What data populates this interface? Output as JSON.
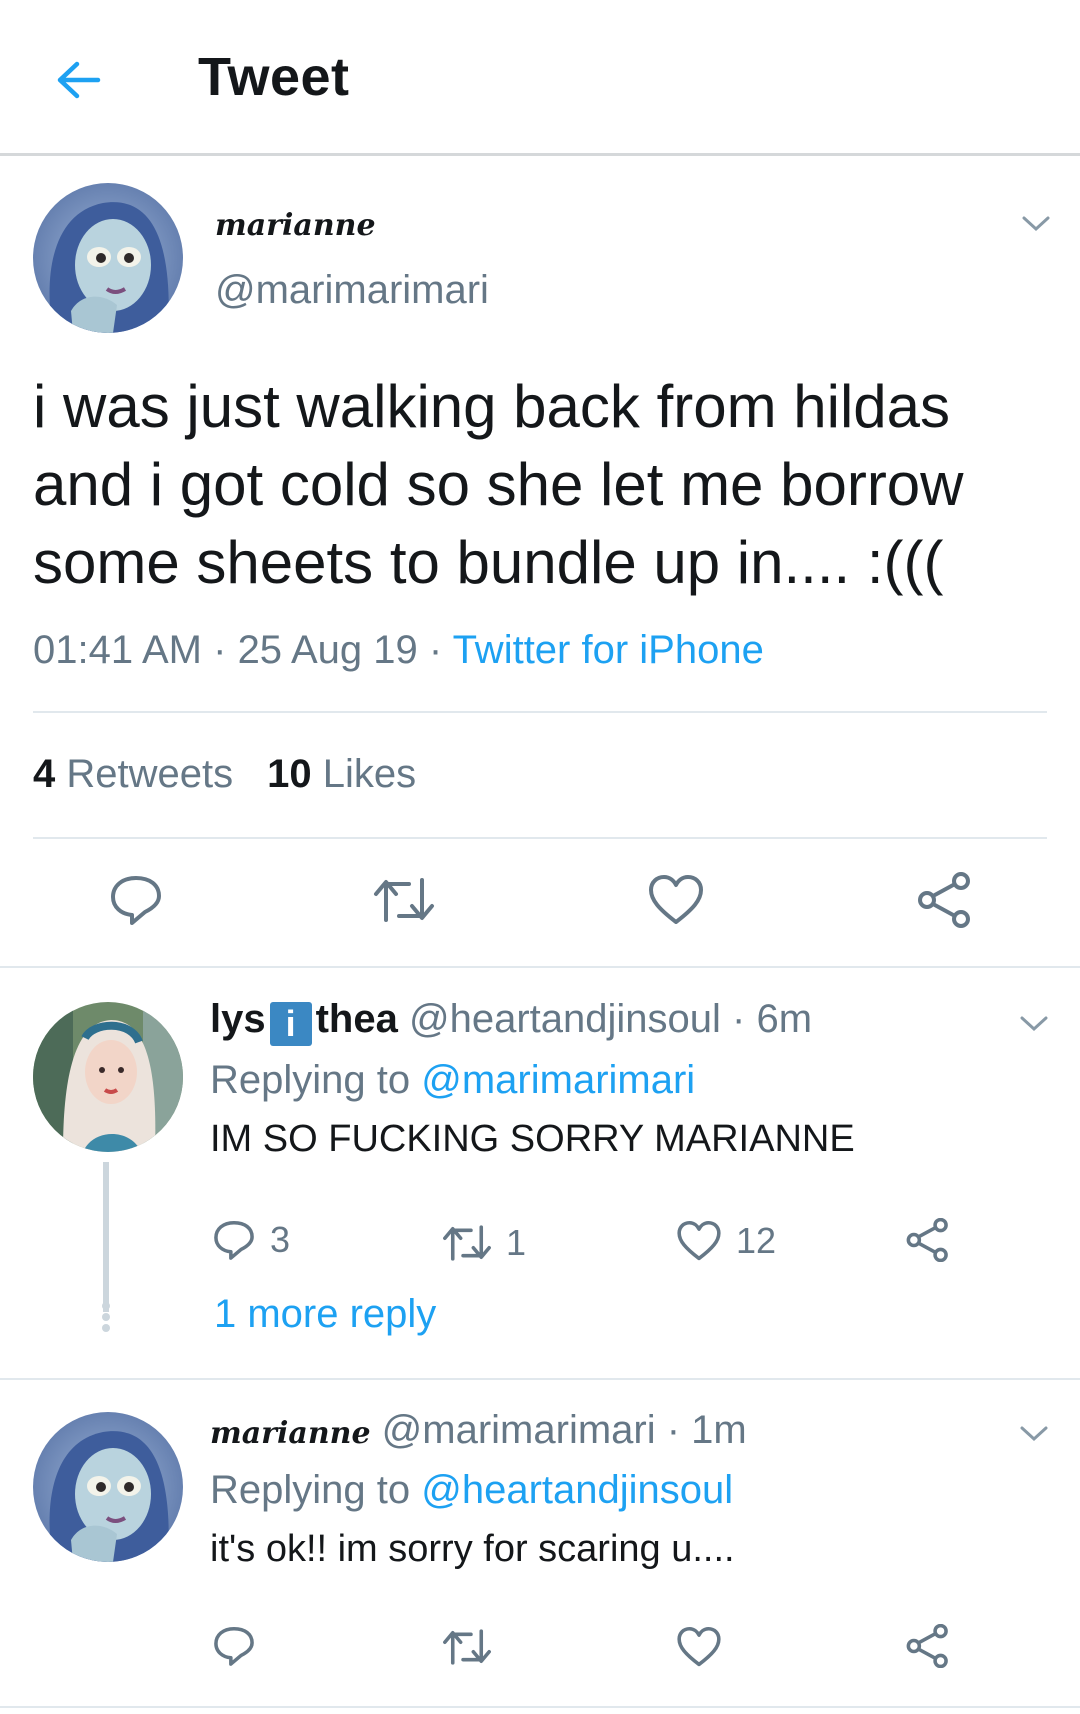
{
  "header": {
    "title": "Tweet"
  },
  "main_tweet": {
    "display_name": "marianne",
    "handle": "@marimarimari",
    "text_lines": [
      "i was just walking back from hildas",
      "and i got cold so she let me borrow",
      "some sheets to bundle up in.... :((("
    ],
    "time": "01:41 AM",
    "date": "25 Aug 19",
    "source": "Twitter for iPhone",
    "separator": " · ",
    "retweets_count": "4",
    "retweets_label": "Retweets",
    "likes_count": "10",
    "likes_label": "Likes"
  },
  "replies": [
    {
      "name_part1": "lys",
      "name_badge": "i",
      "name_part2": "thea",
      "handle": "@heartandjinsoul",
      "age": "6m",
      "replying_prefix": "Replying to",
      "replying_to": "@marimarimari",
      "text": "IM SO FUCKING SORRY MARIANNE",
      "reply_count": "3",
      "retweet_count": "1",
      "like_count": "12",
      "more_replies": "1 more reply"
    },
    {
      "display_name": "marianne",
      "handle": "@marimarimari",
      "age": "1m",
      "replying_prefix": "Replying to",
      "replying_to": "@heartandjinsoul",
      "text": "it's ok!! im sorry for scaring u...."
    }
  ],
  "colors": {
    "link_blue": "#1da1f2",
    "secondary_gray": "#657786",
    "text": "#14171a",
    "divider": "#e1e8ed"
  },
  "icons": [
    "back-arrow-icon",
    "chevron-down-icon",
    "reply-icon",
    "retweet-icon",
    "like-icon",
    "share-icon"
  ]
}
